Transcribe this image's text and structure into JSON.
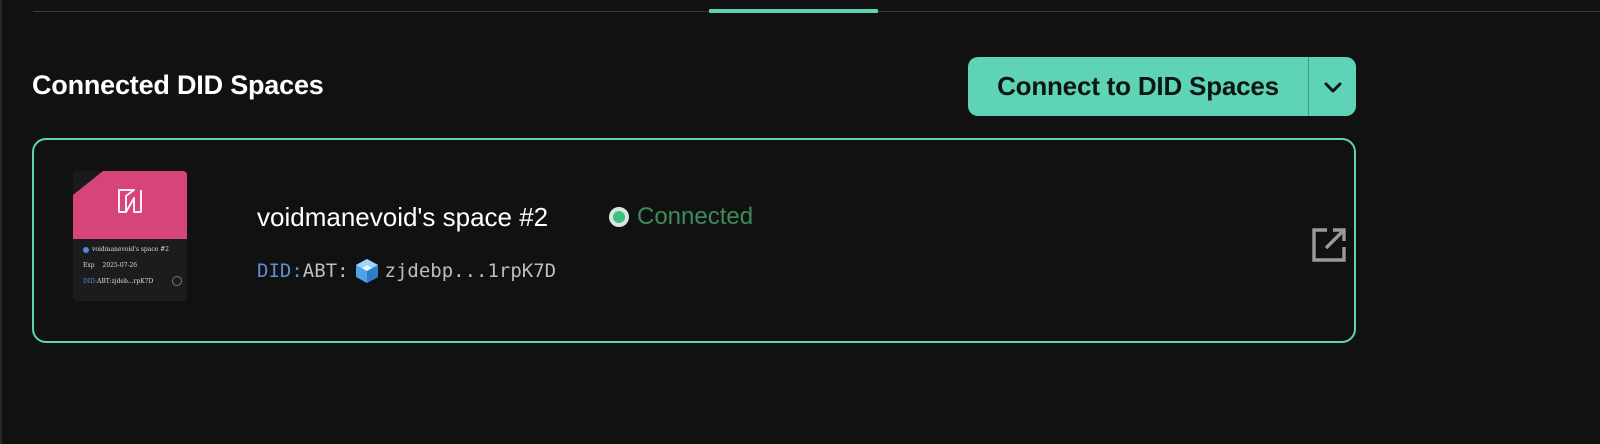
{
  "section": {
    "title": "Connected DID Spaces"
  },
  "connect_button": {
    "label": "Connect to DID Spaces",
    "dropdown_icon": "chevron-down-icon"
  },
  "space": {
    "name": "voidmanevoid's space #2",
    "status": "Connected",
    "did_prefix": "DID:",
    "did_type": "ABT:",
    "did_short": "zjdebp...1rpK7D",
    "open_icon": "open-in-new-icon",
    "card": {
      "name": "voidmanevoid's space #2",
      "exp_label": "Exp",
      "exp_date": "2025-07-26",
      "did_key": "DID:",
      "did_value": "ABT:zjdeb...rpK7D"
    }
  },
  "colors": {
    "accent": "#5fd3b5",
    "card_top": "#d6457a",
    "status_green": "#3d8a5c",
    "did_blue": "#5b8fd6"
  }
}
